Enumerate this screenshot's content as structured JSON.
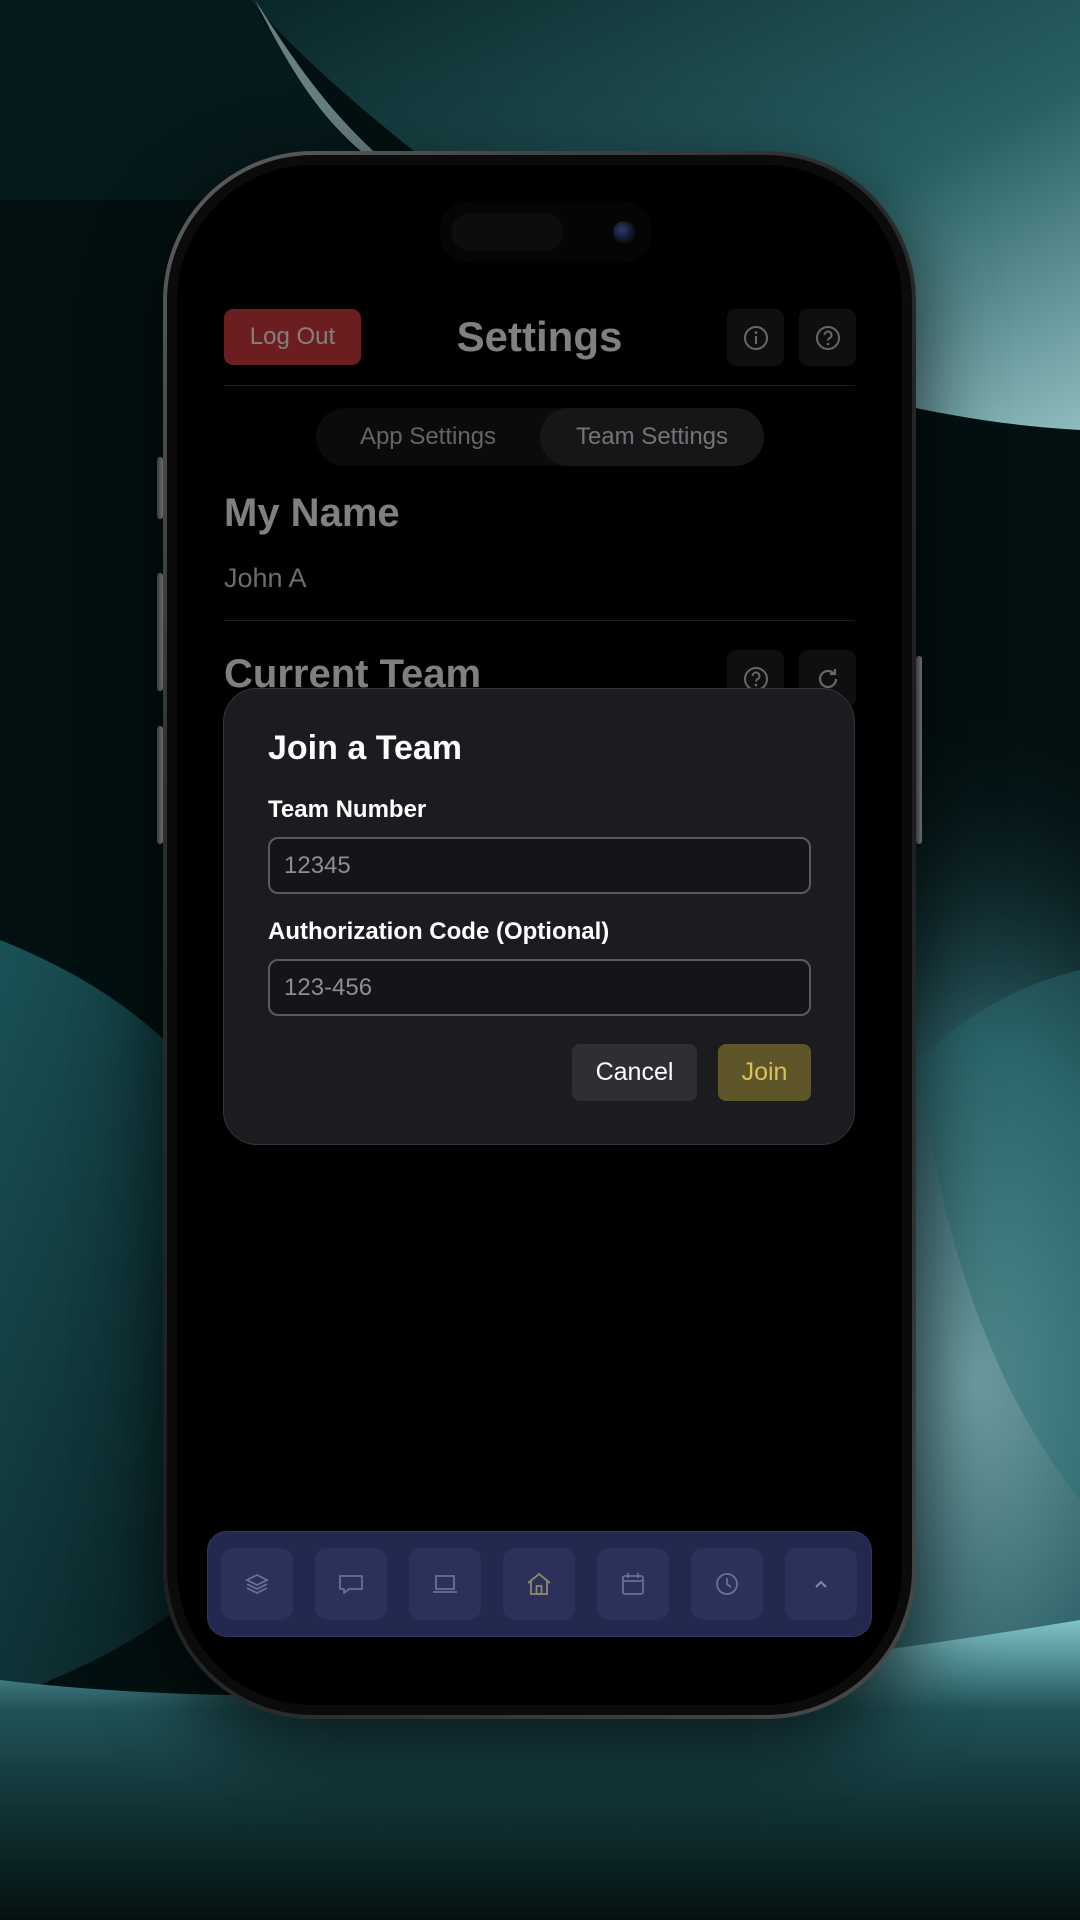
{
  "header": {
    "logout_label": "Log Out",
    "title": "Settings",
    "info_icon": "info-icon",
    "help_icon": "help-icon"
  },
  "tabs": {
    "items": [
      {
        "label": "App Settings",
        "active": false
      },
      {
        "label": "Team Settings",
        "active": true
      }
    ]
  },
  "profile": {
    "heading": "My Name",
    "name": "John A"
  },
  "team": {
    "heading": "Current Team",
    "help_icon": "help-icon",
    "refresh_icon": "refresh-icon"
  },
  "modal": {
    "title": "Join a Team",
    "team_number": {
      "label": "Team Number",
      "placeholder": "12345",
      "value": ""
    },
    "auth_code": {
      "label": "Authorization Code (Optional)",
      "placeholder": "123-456",
      "value": ""
    },
    "cancel_label": "Cancel",
    "join_label": "Join"
  },
  "tabbar": {
    "items": [
      {
        "icon": "layers-icon"
      },
      {
        "icon": "chat-icon"
      },
      {
        "icon": "laptop-icon"
      },
      {
        "icon": "home-icon"
      },
      {
        "icon": "calendar-icon"
      },
      {
        "icon": "clock-icon"
      },
      {
        "icon": "chevron-up-icon"
      }
    ]
  },
  "colors": {
    "logout": "#d73a40",
    "join_text": "#d8c35a",
    "join_bg": "#5e5528",
    "tabbar": "#2a2f5c",
    "modal_bg": "#1b1c20"
  }
}
